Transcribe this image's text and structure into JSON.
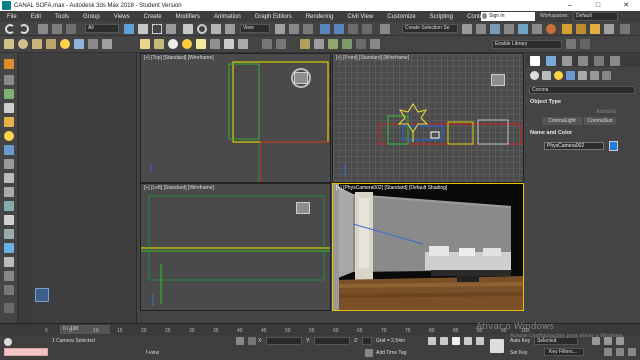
{
  "window": {
    "title": "CANAL SOFA.max - Autodesk 3ds Max 2018 - Student Version",
    "controls": [
      "–",
      "□",
      "✕"
    ]
  },
  "menu": [
    "File",
    "Edit",
    "Tools",
    "Group",
    "Views",
    "Create",
    "Modifiers",
    "Animation",
    "Graph Editors",
    "Rendering",
    "Civil View",
    "Customize",
    "Scripting",
    "Content"
  ],
  "account": {
    "sign_in": "Sign In",
    "workspaces_label": "Workspaces:",
    "workspace": "Default"
  },
  "toolbar": {
    "selection_filter": "All",
    "reference_coord": "View",
    "named_selection": "Create Selection Se",
    "object_paint": "Enable Library"
  },
  "viewports": {
    "top": "[+] [Top] [Standard] [Wireframe]",
    "front": "[+] [Front] [Standard] [Wireframe]",
    "left": "[+] [Left] [Standard] [Wireframe]",
    "camera": "[+] [PhysCamera002] [Standard] [Default Shading]"
  },
  "command_panel": {
    "category": "Corona",
    "object_type_title": "Object Type",
    "autogrid": "AutoGrid",
    "buttons": [
      "CoronaLight",
      "CoronaSun"
    ],
    "name_color_title": "Name and Color",
    "object_name": "PhysCamera002",
    "object_color": "#1f7fe0"
  },
  "timeline": {
    "frame": "0 / 100",
    "ticks": [
      "0",
      "5",
      "10",
      "15",
      "20",
      "25",
      "30",
      "35",
      "40",
      "45",
      "50",
      "55",
      "60",
      "65",
      "70",
      "75",
      "80",
      "85",
      "90",
      "95",
      "100"
    ]
  },
  "status": {
    "selection": "1 Camera Selected",
    "maxscript_hint": "f-view",
    "x_label": "X:",
    "y_label": "Y:",
    "z_label": "Z:",
    "grid": "Grid = 2,54m",
    "add_time_tag": "Add Time Tag",
    "auto_key": "Auto Key",
    "set_key": "Set Key",
    "selected": "Selected",
    "key_filters": "Key Filters..."
  },
  "watermark": {
    "title": "Ativar o Windows",
    "subtitle": "Acesse Configurações para ativar o Windows."
  }
}
